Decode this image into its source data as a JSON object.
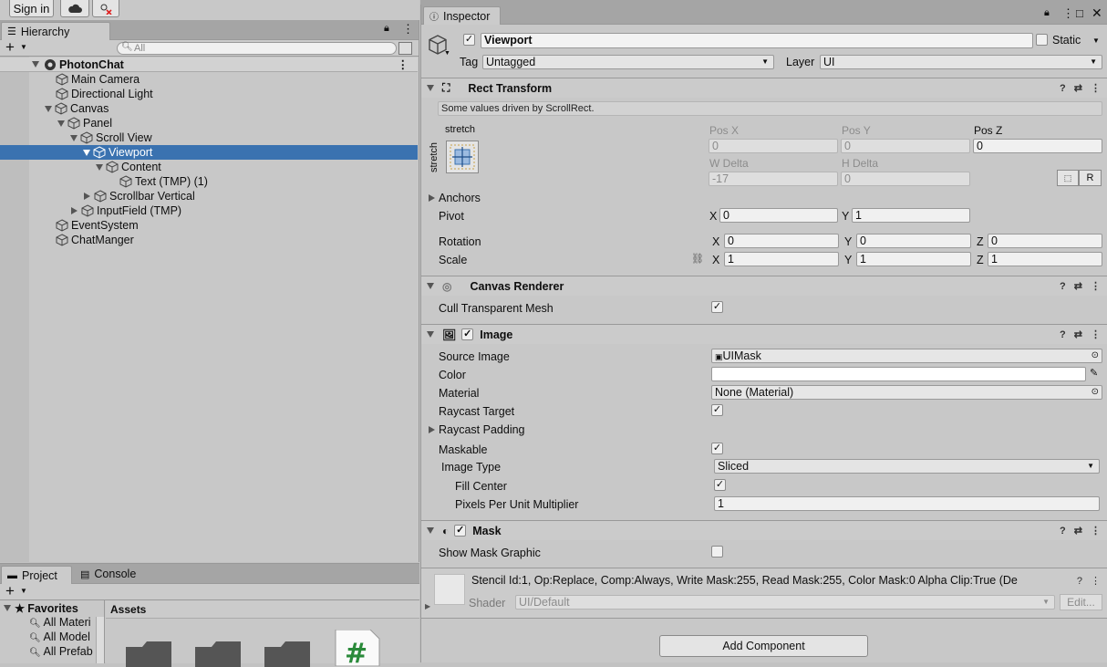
{
  "toolbar": {
    "signin": "Sign in"
  },
  "hierarchy": {
    "tab": "Hierarchy",
    "search_placeholder": "All",
    "scene": "PhotonChat",
    "items": [
      "Main Camera",
      "Directional Light",
      "Canvas",
      "Panel",
      "Scroll View",
      "Viewport",
      "Content",
      "Text (TMP) (1)",
      "Scrollbar Vertical",
      "InputField (TMP)",
      "EventSystem",
      "ChatManger"
    ]
  },
  "project": {
    "tab_project": "Project",
    "tab_console": "Console",
    "favorites": "Favorites",
    "fav_items": [
      "All Materi",
      "All Model",
      "All Prefab"
    ],
    "assets": "Assets"
  },
  "inspector": {
    "tab": "Inspector",
    "object_name": "Viewport",
    "static_label": "Static",
    "tag_label": "Tag",
    "tag_value": "Untagged",
    "layer_label": "Layer",
    "layer_value": "UI",
    "rect": {
      "title": "Rect Transform",
      "note": "Some values driven by ScrollRect.",
      "stretch_top": "stretch",
      "stretch_side": "stretch",
      "posx_label": "Pos X",
      "posy_label": "Pos Y",
      "posz_label": "Pos Z",
      "posx": "0",
      "posy": "0",
      "posz": "0",
      "wdelta_label": "W Delta",
      "hdelta_label": "H Delta",
      "wdelta": "-17",
      "hdelta": "0",
      "r_btn": "R",
      "anchors": "Anchors",
      "pivot": "Pivot",
      "pivot_x": "0",
      "pivot_y": "1",
      "rotation": "Rotation",
      "rot_x": "0",
      "rot_y": "0",
      "rot_z": "0",
      "scale": "Scale",
      "scale_x": "1",
      "scale_y": "1",
      "scale_z": "1",
      "x": "X",
      "y": "Y",
      "z": "Z"
    },
    "canvas_renderer": {
      "title": "Canvas Renderer",
      "cull": "Cull Transparent Mesh"
    },
    "image": {
      "title": "Image",
      "source_image": "Source Image",
      "source_value": "UIMask",
      "color": "Color",
      "material": "Material",
      "material_value": "None (Material)",
      "raycast_target": "Raycast Target",
      "raycast_padding": "Raycast Padding",
      "maskable": "Maskable",
      "image_type": "Image Type",
      "image_type_value": "Sliced",
      "fill_center": "Fill Center",
      "ppu": "Pixels Per Unit Multiplier",
      "ppu_value": "1"
    },
    "mask": {
      "title": "Mask",
      "show_graphic": "Show Mask Graphic"
    },
    "material_preview": {
      "stencil": "Stencil Id:1, Op:Replace, Comp:Always, Write Mask:255, Read Mask:255, Color Mask:0 Alpha Clip:True (De",
      "shader_label": "Shader",
      "shader_value": "UI/Default",
      "edit": "Edit..."
    },
    "add_component": "Add Component"
  }
}
